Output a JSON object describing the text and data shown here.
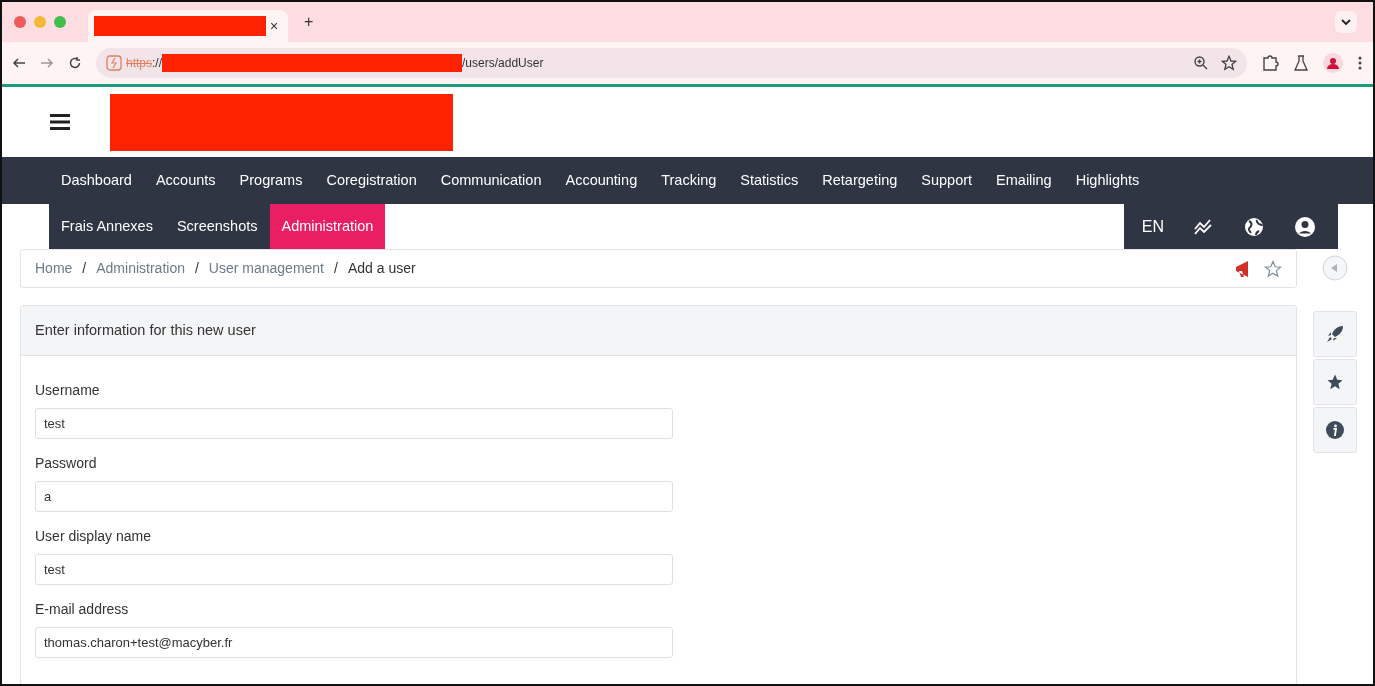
{
  "browser": {
    "tab": {
      "close": "×"
    },
    "new_tab": "+",
    "url": {
      "scheme": "https",
      "separator": "://",
      "path": "/users/addUser"
    }
  },
  "nav": {
    "rows": [
      [
        {
          "label": "Dashboard",
          "selected": false
        },
        {
          "label": "Accounts",
          "selected": false
        },
        {
          "label": "Programs",
          "selected": false
        },
        {
          "label": "Coregistration",
          "selected": false
        },
        {
          "label": "Communication",
          "selected": false
        },
        {
          "label": "Accounting",
          "selected": false
        },
        {
          "label": "Tracking",
          "selected": false
        },
        {
          "label": "Statistics",
          "selected": false
        },
        {
          "label": "Retargeting",
          "selected": false
        },
        {
          "label": "Support",
          "selected": false
        },
        {
          "label": "Emailing",
          "selected": false
        },
        {
          "label": "Highlights",
          "selected": false
        }
      ],
      [
        {
          "label": "Frais Annexes",
          "selected": false
        },
        {
          "label": "Screenshots",
          "selected": false
        },
        {
          "label": "Administration",
          "selected": true
        }
      ]
    ],
    "language": "EN"
  },
  "breadcrumb": [
    {
      "label": "Home",
      "link": true
    },
    {
      "separator": "/",
      "label": "Administration",
      "link": true
    },
    {
      "separator": "/",
      "label": "User management",
      "link": true
    },
    {
      "separator": "/",
      "label": "Add a user",
      "link": false
    }
  ],
  "card": {
    "title": "Enter information for this new user",
    "fields": [
      {
        "label": "Username",
        "value": "test"
      },
      {
        "label": "Password",
        "value": "a"
      },
      {
        "label": "User display name",
        "value": "test"
      },
      {
        "label": "E-mail address",
        "value": "thomas.charon+test@macyber.fr"
      }
    ]
  }
}
